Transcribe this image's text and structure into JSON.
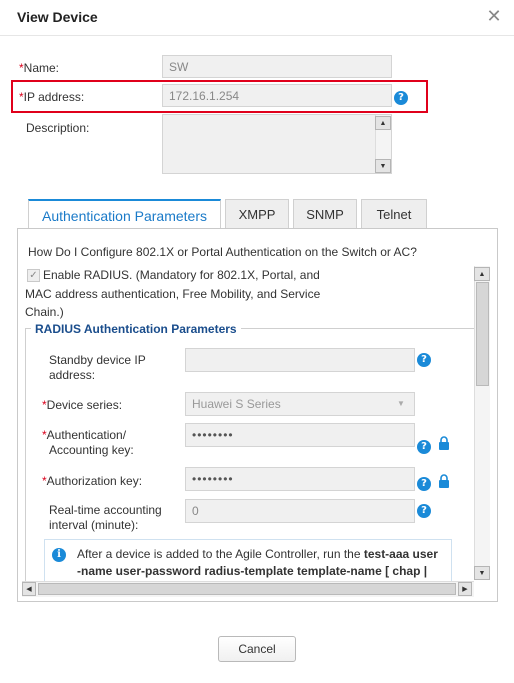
{
  "dialog": {
    "title": "View Device",
    "close_label": "✕"
  },
  "form": {
    "name_required": "*",
    "name_label": "Name:",
    "name_value": "SW",
    "ip_required": "*",
    "ip_label": "IP address:",
    "ip_value": "172.16.1.254",
    "description_label": "Description:",
    "description_value": ""
  },
  "tabs": [
    {
      "label": "Authentication Parameters",
      "active": true
    },
    {
      "label": "XMPP",
      "active": false
    },
    {
      "label": "SNMP",
      "active": false
    },
    {
      "label": "Telnet",
      "active": false
    }
  ],
  "auth": {
    "help_link": "How Do I Configure 802.1X or Portal Authentication on the Switch or AC?",
    "enable_radius_line1": "Enable RADIUS. (Mandatory for 802.1X, Portal, and",
    "enable_radius_line2": "MAC address authentication, Free Mobility, and Service",
    "enable_radius_line3": "Chain.)",
    "legend": "RADIUS Authentication Parameters",
    "standby_label_1": "Standby device IP",
    "standby_label_2": "address:",
    "standby_value": "",
    "device_series_required": "*",
    "device_series_label": "Device series:",
    "device_series_value": "Huawei S Series",
    "auth_key_required": "*",
    "auth_key_label_1": "Authentication/",
    "auth_key_label_2": "Accounting key:",
    "auth_key_value": "••••••••",
    "authz_key_required": "*",
    "authz_key_label": "Authorization key:",
    "authz_key_value": "••••••••",
    "rt_label_1": "Real-time accounting",
    "rt_label_2": "interval (minute):",
    "rt_value": "0",
    "info_text_1": "After a device is added to the Agile Controller, run the ",
    "info_cmd_1": "test-aaa user",
    "info_cmd_2": "-name user-password radius-template template-name [ chap |"
  },
  "footer": {
    "cancel_label": "Cancel"
  },
  "colors": {
    "accent": "#1a8ad8",
    "highlight": "#e0001b"
  }
}
